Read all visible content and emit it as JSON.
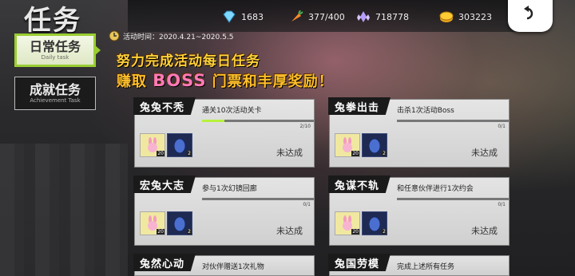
{
  "page": {
    "title": "任务"
  },
  "resources": [
    {
      "icon": "diamond-icon",
      "value": "1683"
    },
    {
      "icon": "carrot-icon",
      "value": "377/400"
    },
    {
      "icon": "crystal-icon",
      "value": "718778"
    },
    {
      "icon": "gold-coin-icon",
      "value": "303223"
    }
  ],
  "tabs": {
    "daily": {
      "label": "日常任务",
      "sub": "Daily task"
    },
    "achievement": {
      "label": "成就任务",
      "sub": "Achievement Task"
    }
  },
  "banner": {
    "time_label": "活动时间：2020.4.21~2020.5.5",
    "line1": "努力完成活动每日任务",
    "line2_prefix": "赚取",
    "line2_boss": "BOSS",
    "line2_suffix": "门票和丰厚奖励！"
  },
  "tasks": [
    {
      "title": "兔兔不秃",
      "desc": "通关10次活动关卡",
      "progress_text": "2/10",
      "progress": 0.2,
      "status": "未达成",
      "rewards": [
        "20",
        "2"
      ]
    },
    {
      "title": "兔拳出击",
      "desc": "击杀1次活动Boss",
      "progress_text": "0/1",
      "progress": 0,
      "status": "未达成",
      "rewards": [
        "20",
        "2"
      ]
    },
    {
      "title": "宏兔大志",
      "desc": "参与1次幻镜回廊",
      "progress_text": "0/1",
      "progress": 0,
      "status": "未达成",
      "rewards": [
        "20",
        "2"
      ]
    },
    {
      "title": "兔谋不轨",
      "desc": "和任意伙伴进行1次约会",
      "progress_text": "0/1",
      "progress": 0,
      "status": "未达成",
      "rewards": [
        "20",
        "2"
      ]
    },
    {
      "title": "兔然心动",
      "desc": "对伙伴赠送1次礼物",
      "progress_text": "",
      "progress": 0,
      "status": "",
      "rewards": []
    },
    {
      "title": "兔国劳模",
      "desc": "完成上述所有任务",
      "progress_text": "",
      "progress": 0,
      "status": "",
      "rewards": []
    }
  ],
  "colors": {
    "accent": "#9acd32",
    "progress": "#b6f23c",
    "banner_text": "#ffd23a"
  }
}
